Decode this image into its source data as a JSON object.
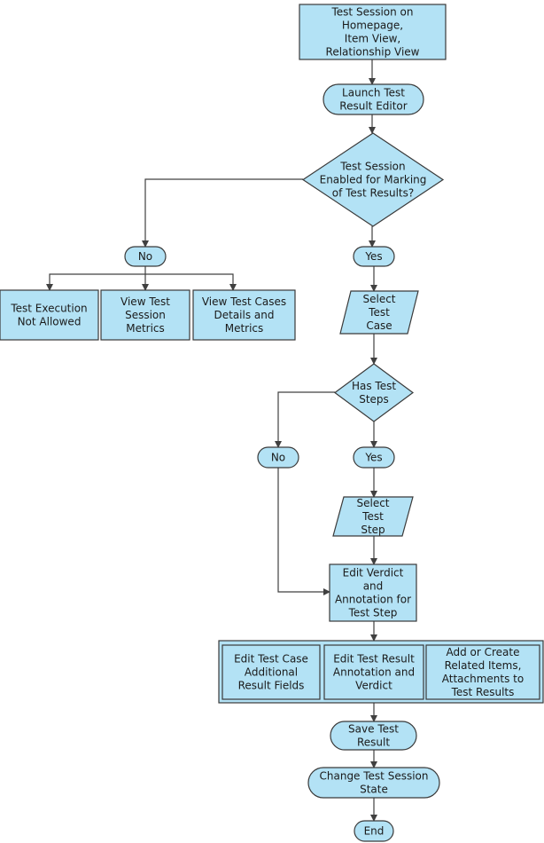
{
  "colors": {
    "node_fill": "#b3e2f5",
    "stroke": "#3a3a3a"
  },
  "nodes": {
    "start": {
      "shape": "rectangle",
      "lines": [
        "Test Session on",
        "Homepage,",
        "Item View,",
        "Relationship View"
      ]
    },
    "launch": {
      "shape": "terminal",
      "lines": [
        "Launch Test",
        "Result Editor"
      ]
    },
    "decision1": {
      "shape": "diamond",
      "lines": [
        "Test Session",
        "Enabled for Marking",
        "of Test Results?"
      ]
    },
    "no1": {
      "shape": "terminal",
      "lines": [
        "No"
      ]
    },
    "yes1": {
      "shape": "terminal",
      "lines": [
        "Yes"
      ]
    },
    "not_allowed": {
      "shape": "rectangle",
      "lines": [
        "Test Execution",
        "Not Allowed"
      ]
    },
    "session_metrics": {
      "shape": "rectangle",
      "lines": [
        "View Test",
        "Session",
        "Metrics"
      ]
    },
    "case_metrics": {
      "shape": "rectangle",
      "lines": [
        "View Test Cases",
        "Details and",
        "Metrics"
      ]
    },
    "select_case": {
      "shape": "parallelogram",
      "lines": [
        "Select",
        "Test",
        "Case"
      ]
    },
    "decision2": {
      "shape": "diamond",
      "lines": [
        "Has Test",
        "Steps"
      ]
    },
    "no2": {
      "shape": "terminal",
      "lines": [
        "No"
      ]
    },
    "yes2": {
      "shape": "terminal",
      "lines": [
        "Yes"
      ]
    },
    "select_step": {
      "shape": "parallelogram",
      "lines": [
        "Select",
        "Test",
        "Step"
      ]
    },
    "edit_verdict": {
      "shape": "rectangle",
      "lines": [
        "Edit Verdict",
        "and",
        "Annotation for",
        "Test Step"
      ]
    },
    "edit_fields": {
      "shape": "rectangle",
      "lines": [
        "Edit Test Case",
        "Additional",
        "Result Fields"
      ]
    },
    "edit_result": {
      "shape": "rectangle",
      "lines": [
        "Edit Test Result",
        "Annotation and",
        "Verdict"
      ]
    },
    "add_related": {
      "shape": "rectangle",
      "lines": [
        "Add or Create",
        "Related Items,",
        "Attachments to",
        "Test Results"
      ]
    },
    "save": {
      "shape": "terminal",
      "lines": [
        "Save Test",
        "Result"
      ]
    },
    "change_state": {
      "shape": "terminal",
      "lines": [
        "Change Test Session",
        "State"
      ]
    },
    "end": {
      "shape": "terminal",
      "lines": [
        "End"
      ]
    }
  },
  "edges": [
    [
      "start",
      "launch"
    ],
    [
      "launch",
      "decision1"
    ],
    [
      "decision1",
      "no1"
    ],
    [
      "decision1",
      "yes1"
    ],
    [
      "no1",
      "not_allowed"
    ],
    [
      "no1",
      "session_metrics"
    ],
    [
      "no1",
      "case_metrics"
    ],
    [
      "yes1",
      "select_case"
    ],
    [
      "select_case",
      "decision2"
    ],
    [
      "decision2",
      "no2"
    ],
    [
      "decision2",
      "yes2"
    ],
    [
      "yes2",
      "select_step"
    ],
    [
      "select_step",
      "edit_verdict"
    ],
    [
      "no2",
      "edit_verdict"
    ],
    [
      "edit_verdict",
      "edit_group"
    ],
    [
      "edit_group",
      "save"
    ],
    [
      "save",
      "change_state"
    ],
    [
      "change_state",
      "end"
    ]
  ]
}
